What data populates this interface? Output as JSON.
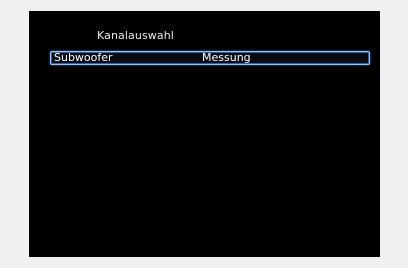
{
  "menu": {
    "title": "Kanalauswahl",
    "rows": [
      {
        "label": "Subwoofer",
        "value": "Messung",
        "selected": true
      }
    ]
  },
  "colors": {
    "outer_background": "#f0f0f0",
    "screen_background": "#000000",
    "text": "#ffffff",
    "selection_border": "#9cc3f0"
  }
}
